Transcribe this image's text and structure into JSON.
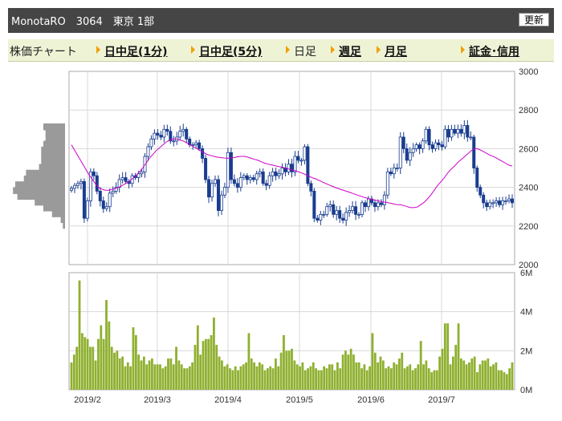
{
  "header": {
    "title": "MonotaRO　3064　東京 1部",
    "refresh_label": "更新"
  },
  "nav": {
    "label": "株価チャート",
    "items": [
      {
        "label": "日中足(1分)",
        "bold": true
      },
      {
        "label": "日中足(5分)",
        "bold": true
      },
      {
        "label": "日足",
        "bold": false
      },
      {
        "label": "週足",
        "bold": true
      },
      {
        "label": "月足",
        "bold": true
      },
      {
        "label": "証金･信用",
        "bold": true
      }
    ]
  },
  "colors": {
    "candle_up": "#ffffff",
    "candle_down": "#1a3d8f",
    "candle_outline": "#1a3d8f",
    "ma": "#cc00cc",
    "volume": "#8fb030",
    "grid": "#d8d8d8",
    "profile": "#9a9a9a"
  },
  "chart_data": [
    {
      "type": "candlestick",
      "title": "",
      "ylim": [
        2000,
        3000
      ],
      "yticks": [
        "2000",
        "2200",
        "2400",
        "2600",
        "2800",
        "3000"
      ],
      "x_tick_labels": [
        "2019/2",
        "2019/3",
        "2019/4",
        "2019/5",
        "2019/6",
        "2019/7"
      ],
      "series": [
        {
          "kind": "closing",
          "values": [
            2395,
            2410,
            2420,
            2430,
            2240,
            2330,
            2480,
            2460,
            2380,
            2330,
            2290,
            2300,
            2370,
            2380,
            2400,
            2440,
            2450,
            2430,
            2420,
            2460,
            2450,
            2470,
            2480,
            2560,
            2610,
            2650,
            2680,
            2670,
            2660,
            2700,
            2690,
            2640,
            2640,
            2660,
            2690,
            2700,
            2650,
            2620,
            2620,
            2630,
            2600,
            2550,
            2440,
            2350,
            2420,
            2440,
            2280,
            2360,
            2400,
            2580,
            2440,
            2420,
            2400,
            2450,
            2460,
            2440,
            2450,
            2440,
            2470,
            2480,
            2420,
            2410,
            2460,
            2480,
            2460,
            2470,
            2500,
            2480,
            2520,
            2480,
            2560,
            2540,
            2540,
            2610,
            2420,
            2380,
            2240,
            2230,
            2260,
            2260,
            2300,
            2310,
            2260,
            2280,
            2240,
            2230,
            2270,
            2280,
            2300,
            2260,
            2260,
            2320,
            2300,
            2340,
            2320,
            2300,
            2320,
            2310,
            2360,
            2480,
            2470,
            2500,
            2500,
            2660,
            2600,
            2540,
            2580,
            2600,
            2620,
            2600,
            2640,
            2700,
            2620,
            2600,
            2630,
            2620,
            2610,
            2700,
            2660,
            2700,
            2680,
            2700,
            2680,
            2720,
            2660,
            2660,
            2500,
            2400,
            2360,
            2320,
            2300,
            2320,
            2320,
            2330,
            2310,
            2330,
            2330,
            2340,
            2320
          ]
        },
        {
          "kind": "moving_average",
          "values": [
            2620,
            2590,
            2560,
            2530,
            2500,
            2470,
            2445,
            2420,
            2400,
            2390,
            2385,
            2385,
            2390,
            2395,
            2400,
            2410,
            2420,
            2430,
            2445,
            2460,
            2480,
            2500,
            2525,
            2550,
            2570,
            2590,
            2605,
            2620,
            2635,
            2645,
            2650,
            2650,
            2645,
            2640,
            2630,
            2620,
            2610,
            2600,
            2590,
            2580,
            2570,
            2565,
            2560,
            2556,
            2554,
            2552,
            2550,
            2552,
            2554,
            2558,
            2560,
            2560,
            2556,
            2550,
            2545,
            2540,
            2532,
            2525,
            2520,
            2516,
            2512,
            2508,
            2505,
            2500,
            2495,
            2490,
            2486,
            2480,
            2474,
            2466,
            2458,
            2450,
            2444,
            2436,
            2428,
            2420,
            2412,
            2405,
            2398,
            2392,
            2386,
            2380,
            2375,
            2368,
            2362,
            2356,
            2350,
            2345,
            2340,
            2336,
            2332,
            2328,
            2324,
            2322,
            2318,
            2314,
            2310,
            2310,
            2306,
            2300,
            2295,
            2295,
            2298,
            2310,
            2322,
            2340,
            2360,
            2385,
            2410,
            2430,
            2450,
            2475,
            2495,
            2510,
            2530,
            2545,
            2560,
            2575,
            2590,
            2600,
            2598,
            2590,
            2580,
            2570,
            2562,
            2555,
            2545,
            2535,
            2525,
            2515,
            2510
          ]
        }
      ]
    },
    {
      "type": "bar",
      "title": "",
      "ylim": [
        0,
        6
      ],
      "yticks": [
        "0M",
        "2M",
        "4M",
        "6M"
      ],
      "x_tick_labels": [
        "2019/2",
        "2019/3",
        "2019/4",
        "2019/5",
        "2019/6",
        "2019/7"
      ],
      "unit": "M",
      "values": [
        1.4,
        1.8,
        2.2,
        5.6,
        2.9,
        2.7,
        2.6,
        2.2,
        2.2,
        1.5,
        2.6,
        3.3,
        2.6,
        4.6,
        3.5,
        2.2,
        1.9,
        2.0,
        1.6,
        1.7,
        1.2,
        1.4,
        1.2,
        3.2,
        2.8,
        1.8,
        1.5,
        1.7,
        1.3,
        1.5,
        1.6,
        1.3,
        1.3,
        1.3,
        1.1,
        1.2,
        1.6,
        1.6,
        1.3,
        2.2,
        1.5,
        1.3,
        1.1,
        1.1,
        1.2,
        1.4,
        2.3,
        3.3,
        1.8,
        2.5,
        2.6,
        2.6,
        2.8,
        3.7,
        2.3,
        1.7,
        1.5,
        1.2,
        1.3,
        1.1,
        1.0,
        1.2,
        1.0,
        1.2,
        1.3,
        1.4,
        2.9,
        1.6,
        1.4,
        1.2,
        1.4,
        1.3,
        1.0,
        1.1,
        1.2,
        1.1,
        1.6,
        1.2,
        1.9,
        2.8,
        2.0,
        2.0,
        2.1,
        1.5,
        1.3,
        1.2,
        1.4,
        1.0,
        1.1,
        1.2,
        1.4,
        1.1,
        1.0,
        1.0,
        1.2,
        1.1,
        1.3,
        1.3,
        1.0,
        1.4,
        1.1,
        1.8,
        2.0,
        1.8,
        2.1,
        1.8,
        1.4,
        1.4,
        1.1,
        1.3,
        1.0,
        1.2,
        2.9,
        1.9,
        1.4,
        1.7,
        1.5,
        1.1,
        1.2,
        1.1,
        1.4,
        1.3,
        1.6,
        1.9,
        1.1,
        1.2,
        1.3,
        1.0,
        1.1,
        1.3,
        2.5,
        1.3,
        1.5,
        1.1,
        0.9,
        1.0,
        1.0,
        1.7,
        2.1,
        3.4,
        3.4,
        1.3,
        1.7,
        2.3,
        3.4,
        1.6,
        1.5,
        1.3,
        1.4,
        1.6,
        1.7,
        0.9,
        1.3,
        1.5,
        1.5,
        1.6,
        1.2,
        1.3,
        1.4,
        1.0,
        1.0,
        0.9,
        0.8,
        1.1,
        1.4
      ]
    },
    {
      "type": "bar",
      "title": "",
      "orientation": "horizontal",
      "price_levels": [
        2200,
        2230,
        2260,
        2290,
        2320,
        2350,
        2380,
        2410,
        2440,
        2470,
        2500,
        2530,
        2560,
        2590,
        2620,
        2650,
        2680,
        2710
      ],
      "values": [
        1,
        2,
        6,
        10,
        14,
        22,
        24,
        23,
        19,
        18,
        12,
        11,
        11,
        11,
        10,
        9,
        9,
        10
      ]
    }
  ]
}
